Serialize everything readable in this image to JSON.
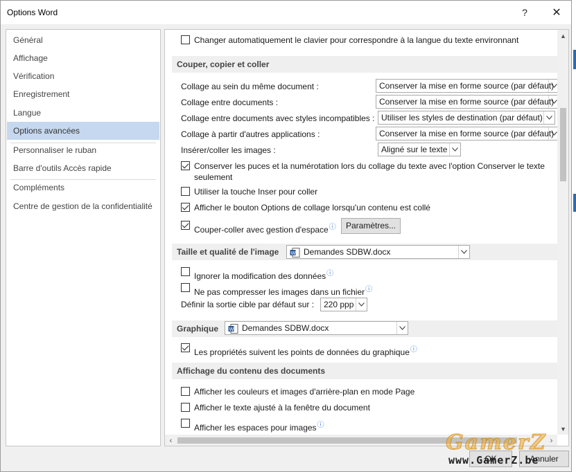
{
  "window": {
    "title": "Options Word",
    "help_glyph": "?",
    "close_glyph": "✕"
  },
  "sidebar": {
    "items": [
      {
        "label": "Général"
      },
      {
        "label": "Affichage"
      },
      {
        "label": "Vérification"
      },
      {
        "label": "Enregistrement"
      },
      {
        "label": "Langue"
      },
      {
        "label": "Options avancées",
        "selected": true
      },
      {
        "label": "Personnaliser le ruban"
      },
      {
        "label": "Barre d'outils Accès rapide"
      },
      {
        "label": "Compléments"
      },
      {
        "label": "Centre de gestion de la confidentialité"
      }
    ]
  },
  "content": {
    "top_option": {
      "label": "Changer automatiquement le clavier pour correspondre à la langue du texte environnant",
      "checked": false
    },
    "cut_copy_paste": {
      "heading": "Couper, copier et coller",
      "paste_rows": [
        {
          "label": "Collage au sein du même document :",
          "value": "Conserver la mise en forme source (par défaut)"
        },
        {
          "label": "Collage entre documents :",
          "value": "Conserver la mise en forme source (par défaut)"
        },
        {
          "label": "Collage entre documents avec styles incompatibles :",
          "value": "Utiliser les styles de destination (par défaut)"
        },
        {
          "label": "Collage à partir d'autres applications :",
          "value": "Conserver la mise en forme source (par défaut)"
        }
      ],
      "insert_images": {
        "label": "Insérer/coller les images :",
        "value": "Aligné sur le texte"
      },
      "keep_bullets": {
        "line1": "Conserver les puces et la numérotation lors du collage du texte avec l'option Conserver le texte",
        "line2": "seulement",
        "checked": true
      },
      "use_insert_key": {
        "label": "Utiliser la touche Inser pour coller",
        "checked": false
      },
      "show_paste_options": {
        "label": "Afficher le bouton Options de collage lorsqu'un contenu est collé",
        "checked": true
      },
      "smart_cut_paste": {
        "label": "Couper-coller avec gestion d'espace",
        "checked": true,
        "info": "ⓘ",
        "button": "Paramètres..."
      }
    },
    "image_size": {
      "heading": "Taille et qualité de l'image",
      "document": "Demandes SDBW.docx",
      "discard_edit": {
        "label": "Ignorer la modification des données",
        "checked": false,
        "info": "ⓘ"
      },
      "no_compress": {
        "label": "Ne pas compresser les images dans un fichier",
        "checked": false,
        "info": "ⓘ"
      },
      "default_output": {
        "label": "Définir la sortie cible par défaut sur :",
        "value": "220 ppp"
      }
    },
    "chart": {
      "heading": "Graphique",
      "document": "Demandes SDBW.docx",
      "properties_follow": {
        "label": "Les propriétés suivent les points de données du graphique",
        "checked": true,
        "info": "ⓘ"
      }
    },
    "doc_content": {
      "heading": "Affichage du contenu des documents",
      "show_bg": {
        "label": "Afficher les couleurs et images d'arrière-plan en mode Page",
        "checked": false
      },
      "wrap_text": {
        "label": "Afficher le texte ajusté à la fenêtre du document",
        "checked": false
      },
      "show_placeholders": {
        "label": "Afficher les espaces pour images",
        "checked": false,
        "info": "ⓘ"
      }
    }
  },
  "footer": {
    "ok": "OK",
    "cancel": "Annuler"
  },
  "watermark": {
    "top": "GamerZ",
    "bottom": "www.GamerZ.be"
  },
  "colors": {
    "selected_bg": "#c5d8ef",
    "section_bg": "#efefef",
    "info_blue": "#3a7bd5"
  }
}
